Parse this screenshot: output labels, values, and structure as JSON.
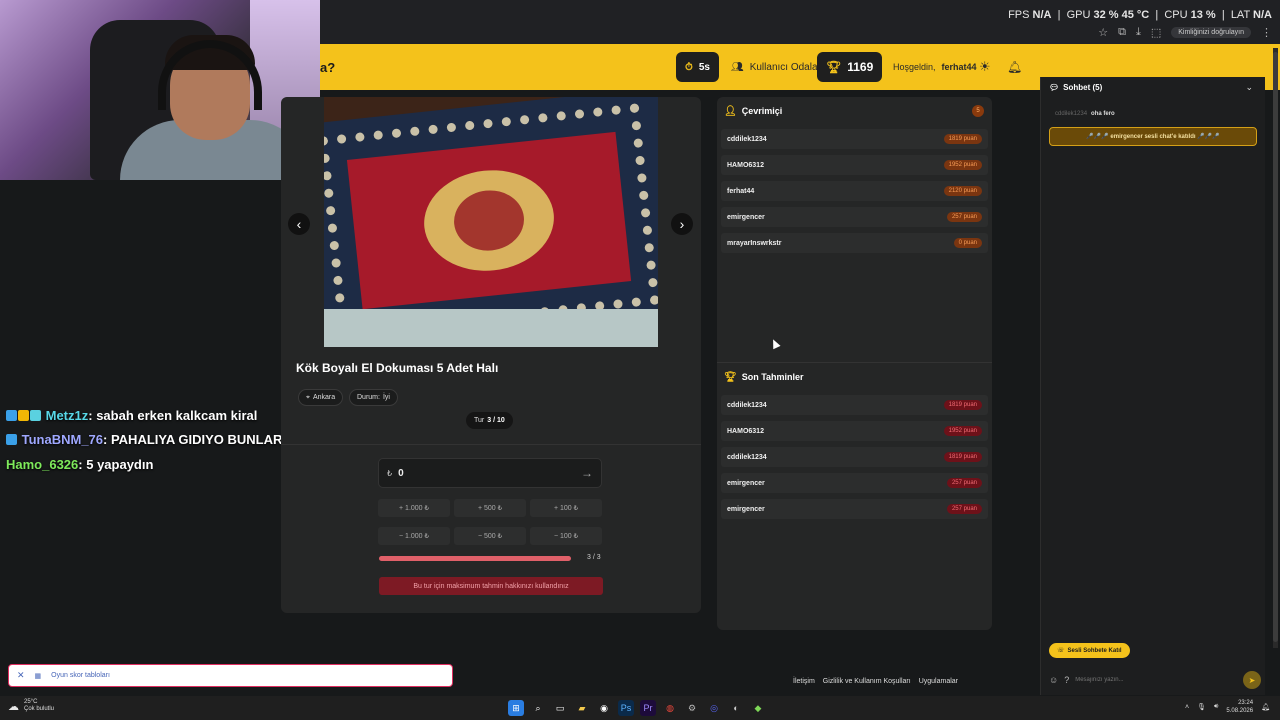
{
  "perf": {
    "fps_label": "FPS",
    "fps": "N/A",
    "gpu_label": "GPU",
    "gpu": "32 % 45 °C",
    "cpu_label": "CPU",
    "cpu": "13 %",
    "lat_label": "LAT",
    "lat": "N/A"
  },
  "browser": {
    "verify_label": "Kimliğinizi doğrulayın"
  },
  "header": {
    "title": "a?",
    "timer": "5s",
    "rooms_label": "Kullanıcı Odaları",
    "score": "1169",
    "welcome_prefix": "Hoşgeldin,",
    "username": "ferhat44"
  },
  "stream_chat": [
    {
      "user": "Metz1z",
      "text": ": sabah erken kalkcam kiral"
    },
    {
      "user": "TunaBNM_76",
      "text": ": PAHALIYA GIDIYO BUNLAR"
    },
    {
      "user": "Hamo_6326",
      "text": ": 5 yapaydın"
    }
  ],
  "product": {
    "title": "Kök Boyalı El Dokuması 5 Adet Halı",
    "location": "Ankara",
    "condition_label": "Durum:",
    "condition": "İyi",
    "round_label": "Tur",
    "round": "3 / 10",
    "currency": "₺",
    "guess_value": "0",
    "amount_buttons_row1": [
      "+ 1.000 ₺",
      "+ 500 ₺",
      "+ 100 ₺"
    ],
    "amount_buttons_row2": [
      "− 1.000 ₺",
      "− 500 ₺",
      "− 100 ₺"
    ],
    "guesses_used": "3 / 3",
    "progress_fraction": 1.0,
    "max_guess_message": "Bu tur için maksimum tahmin hakkınızı kullandınız"
  },
  "online": {
    "title": "Çevrimiçi",
    "count": "5",
    "players": [
      {
        "name": "cddilek1234",
        "points": "1819 puan"
      },
      {
        "name": "HAMO6312",
        "points": "1952 puan"
      },
      {
        "name": "ferhat44",
        "points": "2120 puan"
      },
      {
        "name": "emirgencer",
        "points": "257 puan"
      },
      {
        "name": "mrayarInswrkstr",
        "points": "0 puan"
      }
    ]
  },
  "recent_guesses": {
    "title": "Son Tahminler",
    "items": [
      {
        "name": "cddilek1234",
        "points": "1819 puan"
      },
      {
        "name": "HAMO6312",
        "points": "1952 puan"
      },
      {
        "name": "cddilek1234",
        "points": "1819 puan"
      },
      {
        "name": "emirgencer",
        "points": "257 puan"
      },
      {
        "name": "emirgencer",
        "points": "257 puan"
      }
    ]
  },
  "chat": {
    "title": "Sohbet (5)",
    "msg1_user": "cddilek1234",
    "msg1_text": "oha fero",
    "join_notice": "🎤🎤🎤 emirgencer sesli chat'e katıldı 🎤🎤🎤",
    "voice_join": "Sesli Sohbete Katıl",
    "input_placeholder": "Mesajınızı yazın..."
  },
  "footer": {
    "links": [
      "İletişim",
      "Gizlilik ve Kullanım Koşulları",
      "Uygulamalar"
    ]
  },
  "notification": {
    "text": "Oyun skor tabloları"
  },
  "taskbar": {
    "temp": "25°C",
    "weather": "Çok bulutlu",
    "time": "23:24",
    "date": "5.08.2026"
  },
  "colors": {
    "accent": "#f4c21b",
    "panel": "#252626",
    "danger": "#7d1a24"
  }
}
